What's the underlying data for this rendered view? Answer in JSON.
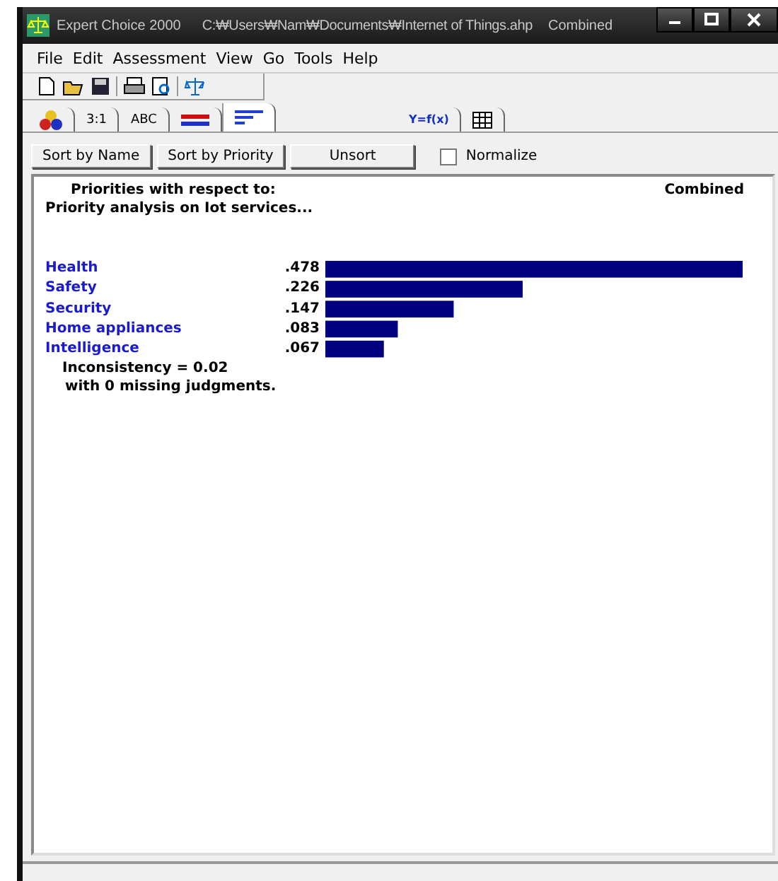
{
  "window": {
    "title": "Expert Choice 2000",
    "path": "C:₩Users₩Nam₩Documents₩Internet of Things.ahp",
    "mode": "Combined"
  },
  "menu": [
    "File",
    "Edit",
    "Assessment",
    "View",
    "Go",
    "Tools",
    "Help"
  ],
  "tabs": [
    {
      "kind": "icon",
      "selected": false
    },
    {
      "kind": "text",
      "label": "3:1",
      "selected": false
    },
    {
      "kind": "text",
      "label": "ABC",
      "selected": false
    },
    {
      "kind": "icon",
      "selected": false
    },
    {
      "kind": "icon",
      "selected": true
    },
    {
      "kind": "text",
      "label": "Y=f(x)",
      "selected": false
    },
    {
      "kind": "icon",
      "selected": false
    }
  ],
  "buttons": [
    {
      "label": "Sort by Name"
    },
    {
      "label": "Sort by Priority"
    },
    {
      "label": "Unsort"
    }
  ],
  "normalize": {
    "label": "Normalize",
    "checked": false
  },
  "report": {
    "heading": "Priorities with respect to:",
    "goal": "Priority analysis on Iot services...",
    "mode": "Combined",
    "chart_data": {
      "type": "bar",
      "orientation": "horizontal",
      "categories": [
        "Health",
        "Safety",
        "Security",
        "Home appliances",
        "Intelligence"
      ],
      "values": [
        0.478,
        0.226,
        0.147,
        0.083,
        0.067
      ],
      "value_labels": [
        ".478",
        ".226",
        ".147",
        ".083",
        ".067"
      ]
    },
    "inconsistency": "Inconsistency = 0.02",
    "missing": "with 0  missing judgments."
  }
}
